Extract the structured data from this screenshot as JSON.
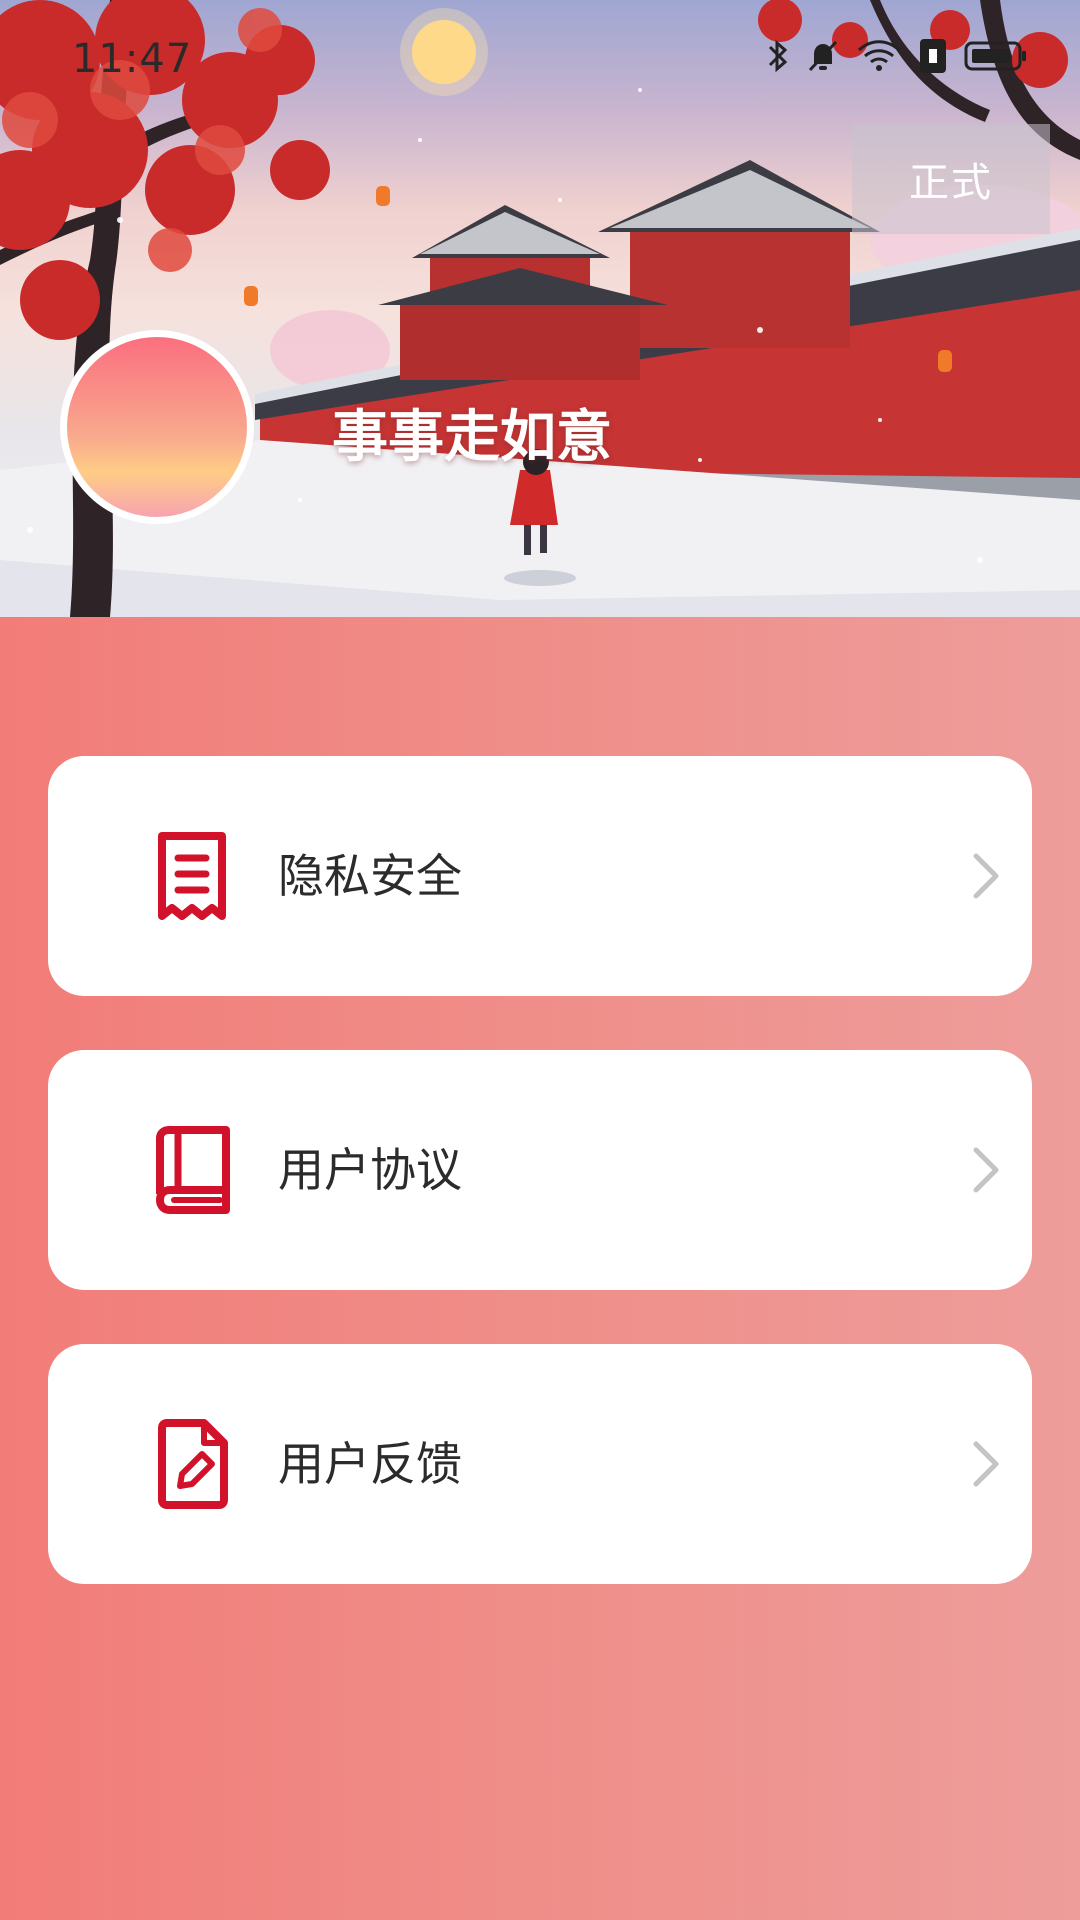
{
  "status_bar": {
    "time": "11:47",
    "icons": [
      "bluetooth-icon",
      "mute-bell-icon",
      "wifi-icon",
      "sim-icon",
      "battery-icon"
    ]
  },
  "header": {
    "env_badge": "正式",
    "username": "事事走如意"
  },
  "menu": {
    "items": [
      {
        "label": "隐私安全",
        "icon": "receipt-icon"
      },
      {
        "label": "用户协议",
        "icon": "book-icon"
      },
      {
        "label": "用户反馈",
        "icon": "edit-document-icon"
      }
    ]
  },
  "colors": {
    "accent": "#d1122a",
    "background_start": "#f27c78",
    "background_end": "#ee9d9b",
    "card": "#ffffff",
    "chevron": "#c4c4c4"
  }
}
